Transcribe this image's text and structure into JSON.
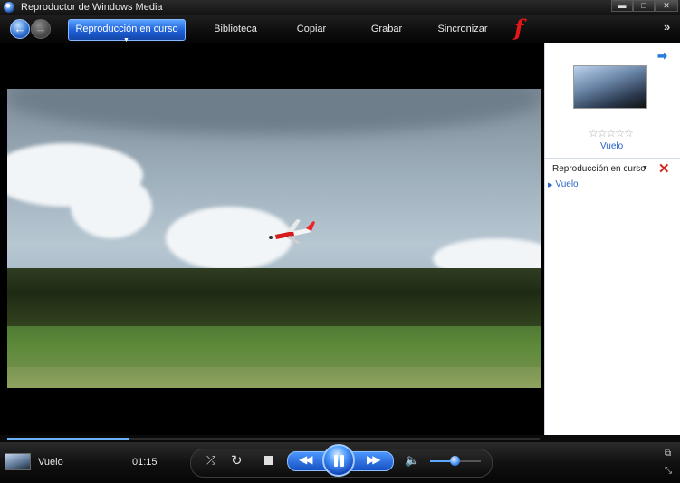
{
  "window": {
    "title": "Reproductor de Windows Media",
    "minimize_glyph": "▬",
    "maximize_glyph": "□",
    "close_glyph": "✕"
  },
  "nav": {
    "back_glyph": "←",
    "forward_glyph": "→",
    "tabs": [
      {
        "label": "Reproducción en curso",
        "active": true
      },
      {
        "label": "Biblioteca"
      },
      {
        "label": "Copiar"
      },
      {
        "label": "Grabar"
      },
      {
        "label": "Sincronizar"
      }
    ],
    "brand_glyph": "f",
    "more_glyph": "»"
  },
  "now_playing": {
    "rating_glyphs": "☆☆☆☆☆",
    "title": "Vuelo",
    "arrow_glyph": "➡"
  },
  "playlist": {
    "label": "Reproducción en curso",
    "clear_glyph": "✕",
    "items": [
      "Vuelo"
    ]
  },
  "player": {
    "track_name": "Vuelo",
    "time": "01:15",
    "progress": 0.23,
    "volume": 0.5
  },
  "colors": {
    "accent": "#2e6fd1",
    "brand": "#e01818",
    "link": "#2a63c7"
  },
  "icons": {
    "shuffle": "shuffle-icon",
    "repeat": "repeat-icon",
    "stop": "stop-icon",
    "rewind": "rewind-icon",
    "play_pause": "pause-icon",
    "fast_forward": "fast-forward-icon",
    "volume": "volume-icon"
  }
}
